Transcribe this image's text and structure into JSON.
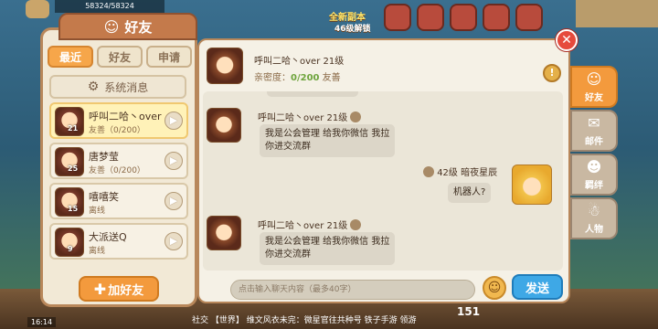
{
  "header_title": "好友",
  "tabs": [
    {
      "label": "最近",
      "active": true
    },
    {
      "label": "好友",
      "active": false
    },
    {
      "label": "申请",
      "active": false
    }
  ],
  "system_message_label": "系统消息",
  "friends": [
    {
      "name": "呼叫二哈丶over",
      "status": "友善（0/200）",
      "level": "21",
      "selected": true
    },
    {
      "name": "唐梦莹",
      "status": "友善（0/200）",
      "level": "25",
      "selected": false
    },
    {
      "name": "嘻嘻笑",
      "status": "离线",
      "level": "15",
      "selected": false
    },
    {
      "name": "大派送Q",
      "status": "离线",
      "level": "9",
      "selected": false
    }
  ],
  "add_friend_label": "加好友",
  "chat": {
    "header_name": "呼叫二哈丶over  21级",
    "intimacy_label": "亲密度：",
    "intimacy_value": "0/200",
    "intimacy_status": "友善",
    "messages": [
      {
        "side": "left",
        "name": "呼叫二哈丶over 21级",
        "text_line1": "我是公会管理 给我你微信 我拉",
        "text_line2": "你进交流群"
      },
      {
        "side": "right",
        "name": "42级 暗夜星辰",
        "text_line1": "机器人?",
        "text_line2": ""
      },
      {
        "side": "left",
        "name": "呼叫二哈丶over 21级",
        "text_line1": "我是公会管理 给我你微信 我拉",
        "text_line2": "你进交流群"
      }
    ],
    "input_placeholder": "点击输入聊天内容（最多40字）",
    "send_label": "发送"
  },
  "side_tabs": [
    {
      "label": "好友",
      "active": true,
      "icon": "friends-icon"
    },
    {
      "label": "邮件",
      "active": false,
      "icon": "mail-icon"
    },
    {
      "label": "羁绊",
      "active": false,
      "icon": "bond-icon"
    },
    {
      "label": "人物",
      "active": false,
      "icon": "character-icon"
    }
  ],
  "background": {
    "resources": "58324/58324",
    "new_dungeon": "全新副本",
    "unlock": "46级解锁",
    "chat_ticker": "社交 【世界】 维文风衣未完：微星官往共种号 铁子手游 领游",
    "time": "16:14",
    "counter": "151"
  },
  "colors": {
    "accent_orange": "#f39a3d",
    "send_blue": "#3ea8e6",
    "intimacy_green": "#6ea43d",
    "close_red": "#e64a3c"
  }
}
